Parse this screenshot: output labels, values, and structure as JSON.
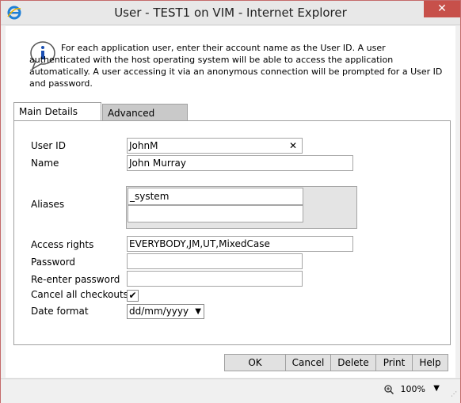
{
  "window": {
    "title": "User - TEST1 on VIM - Internet Explorer",
    "close_label": "✕"
  },
  "info": {
    "text": "For each application user, enter their account name as the User ID.  A user authenticated with the host operating system will be able to access the application automatically.  A user accessing it via an anonymous connection will be prompted for a User ID and password."
  },
  "tabs": [
    {
      "label": "Main Details"
    },
    {
      "label": "Advanced"
    }
  ],
  "form": {
    "user_id_label": "User ID",
    "user_id_value": "JohnM",
    "clear_icon": "✕",
    "name_label": "Name",
    "name_value": "John Murray",
    "aliases_label": "Aliases",
    "aliases": [
      "_system",
      ""
    ],
    "access_rights_label": "Access rights",
    "access_rights_value": "EVERYBODY,JM,UT,MixedCase",
    "password_label": "Password",
    "password_value": "",
    "reenter_label": "Re-enter password",
    "reenter_value": "",
    "cancel_checkouts_label": "Cancel all checkouts?",
    "cancel_checkouts_checked": true,
    "check_mark": "✔",
    "date_format_label": "Date format",
    "date_format_value": "dd/mm/yyyy"
  },
  "buttons": {
    "ok": "OK",
    "cancel": "Cancel",
    "delete": "Delete",
    "print": "Print",
    "help": "Help"
  },
  "status": {
    "zoom": "100%"
  }
}
